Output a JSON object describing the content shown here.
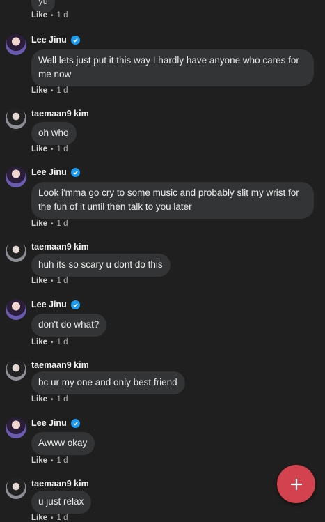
{
  "top_partial": {
    "text": "yu",
    "like_label": "Like",
    "separator": "•",
    "time": "1 d"
  },
  "comments": [
    {
      "author": "Lee Jinu",
      "verified": true,
      "text": "Well lets just put it this way I hardly have anyone who cares for me now",
      "like_label": "Like",
      "separator": "•",
      "time": "1 d"
    },
    {
      "author": "taemaan9 kim",
      "verified": false,
      "text": "oh who",
      "like_label": "Like",
      "separator": "•",
      "time": "1 d"
    },
    {
      "author": "Lee Jinu",
      "verified": true,
      "text": "Look i'mma go cry to some music and probably slit my wrist for the fun of it until then talk to you later",
      "like_label": "Like",
      "separator": "•",
      "time": "1 d"
    },
    {
      "author": "taemaan9 kim",
      "verified": false,
      "text": "huh its so scary u dont do this",
      "like_label": "Like",
      "separator": "•",
      "time": "1 d"
    },
    {
      "author": "Lee Jinu",
      "verified": true,
      "text": "don't do what?",
      "like_label": "Like",
      "separator": "•",
      "time": "1 d"
    },
    {
      "author": "taemaan9 kim",
      "verified": false,
      "text": "bc ur my one and only best friend",
      "like_label": "Like",
      "separator": "•",
      "time": "1 d"
    },
    {
      "author": "Lee Jinu",
      "verified": true,
      "text": "Awww okay",
      "like_label": "Like",
      "separator": "•",
      "time": "1 d"
    },
    {
      "author": "taemaan9 kim",
      "verified": false,
      "text": "u just relax",
      "like_label": "Like",
      "separator": "•",
      "time": "1 d"
    }
  ],
  "fab": {
    "icon": "plus-icon",
    "color": "#d2434f"
  },
  "colors": {
    "background": "#1f1f1f",
    "bubble": "#333435",
    "verified": "#1d9bf0"
  }
}
